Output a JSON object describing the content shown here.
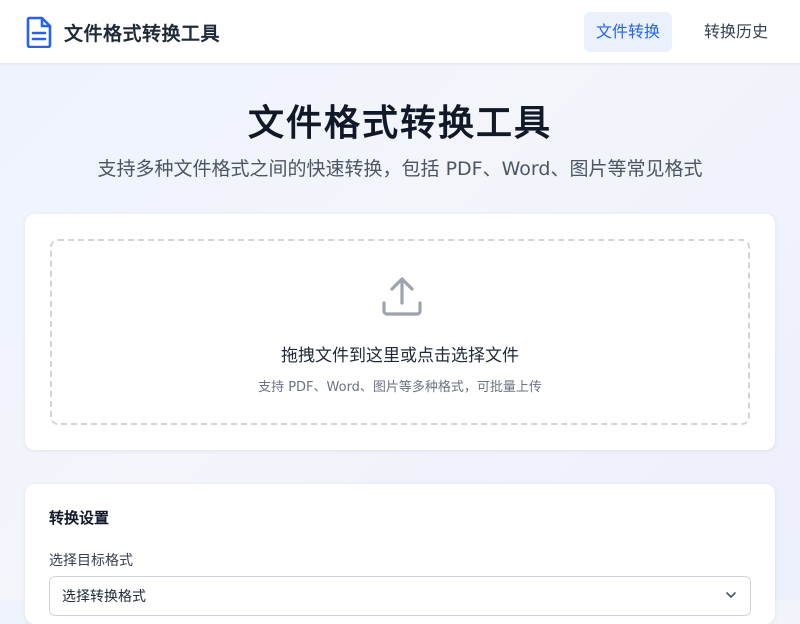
{
  "header": {
    "brand_title": "文件格式转换工具",
    "brand_icon": "document-icon",
    "nav": [
      {
        "label": "文件转换",
        "active": true
      },
      {
        "label": "转换历史",
        "active": false
      }
    ]
  },
  "hero": {
    "title": "文件格式转换工具",
    "subtitle": "支持多种文件格式之间的快速转换，包括 PDF、Word、图片等常见格式"
  },
  "upload": {
    "icon": "upload-icon",
    "title": "拖拽文件到这里或点击选择文件",
    "hint": "支持 PDF、Word、图片等多种格式，可批量上传"
  },
  "settings": {
    "title": "转换设置",
    "target_label": "选择目标格式",
    "target_select": {
      "value": "选择转换格式",
      "icon": "chevron-down-icon"
    }
  },
  "colors": {
    "accent": "#2563eb",
    "accent_bg": "#eaf1fd",
    "text_primary": "#111827",
    "text_secondary": "#4b5563"
  }
}
